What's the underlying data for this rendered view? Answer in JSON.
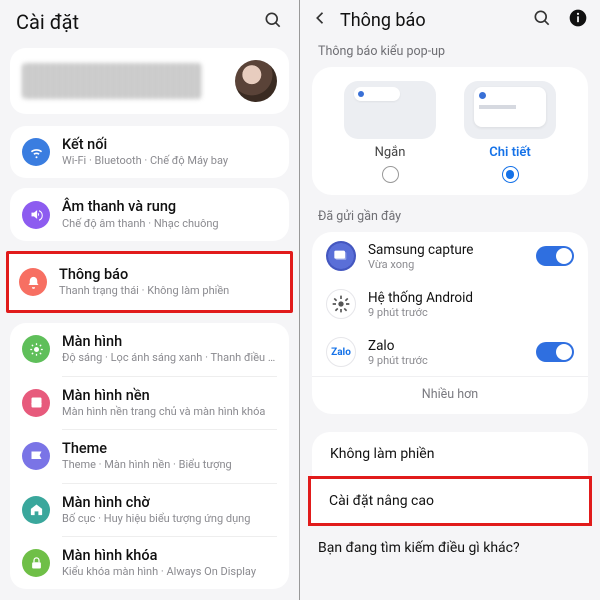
{
  "left": {
    "title": "Cài đặt",
    "items": [
      {
        "icon": "wifi",
        "color": "ic-blue",
        "title": "Kết nối",
        "sub": "Wi-Fi · Bluetooth · Chế độ Máy bay"
      },
      {
        "icon": "sound",
        "color": "ic-purple",
        "title": "Âm thanh và rung",
        "sub": "Chế độ âm thanh · Nhạc chuông"
      },
      {
        "icon": "bell",
        "color": "ic-coral",
        "title": "Thông báo",
        "sub": "Thanh trạng thái · Không làm phiền",
        "highlight": true
      },
      {
        "icon": "sun",
        "color": "ic-green",
        "title": "Màn hình",
        "sub": "Độ sáng · Lọc ánh sáng xanh · Thanh điều hướng"
      },
      {
        "icon": "wall",
        "color": "ic-pink",
        "title": "Màn hình nền",
        "sub": "Màn hình nền trang chủ và màn hình khóa"
      },
      {
        "icon": "theme",
        "color": "ic-violet",
        "title": "Theme",
        "sub": "Theme · Màn hình nền · Biểu tượng"
      },
      {
        "icon": "home",
        "color": "ic-teal",
        "title": "Màn hình chờ",
        "sub": "Bố cục · Huy hiệu biểu tượng ứng dụng"
      },
      {
        "icon": "lock",
        "color": "ic-lime",
        "title": "Màn hình khóa",
        "sub": "Kiểu khóa màn hình · Always On Display"
      }
    ]
  },
  "right": {
    "title": "Thông báo",
    "popup_section": "Thông báo kiểu pop-up",
    "popup_short": "Ngắn",
    "popup_detail": "Chi tiết",
    "recent_section": "Đã gửi gần đây",
    "recent": [
      {
        "name": "Samsung capture",
        "sub": "Vừa xong",
        "icon": "samsung",
        "toggle": true
      },
      {
        "name": "Hệ thống Android",
        "sub": "9 phút trước",
        "icon": "android",
        "toggle": false
      },
      {
        "name": "Zalo",
        "sub": "9 phút trước",
        "icon": "zalo",
        "toggle": true
      }
    ],
    "more": "Nhiều hơn",
    "dnd": "Không làm phiền",
    "advanced": "Cài đặt nâng cao",
    "footer": "Bạn đang tìm kiếm điều gì khác?"
  }
}
